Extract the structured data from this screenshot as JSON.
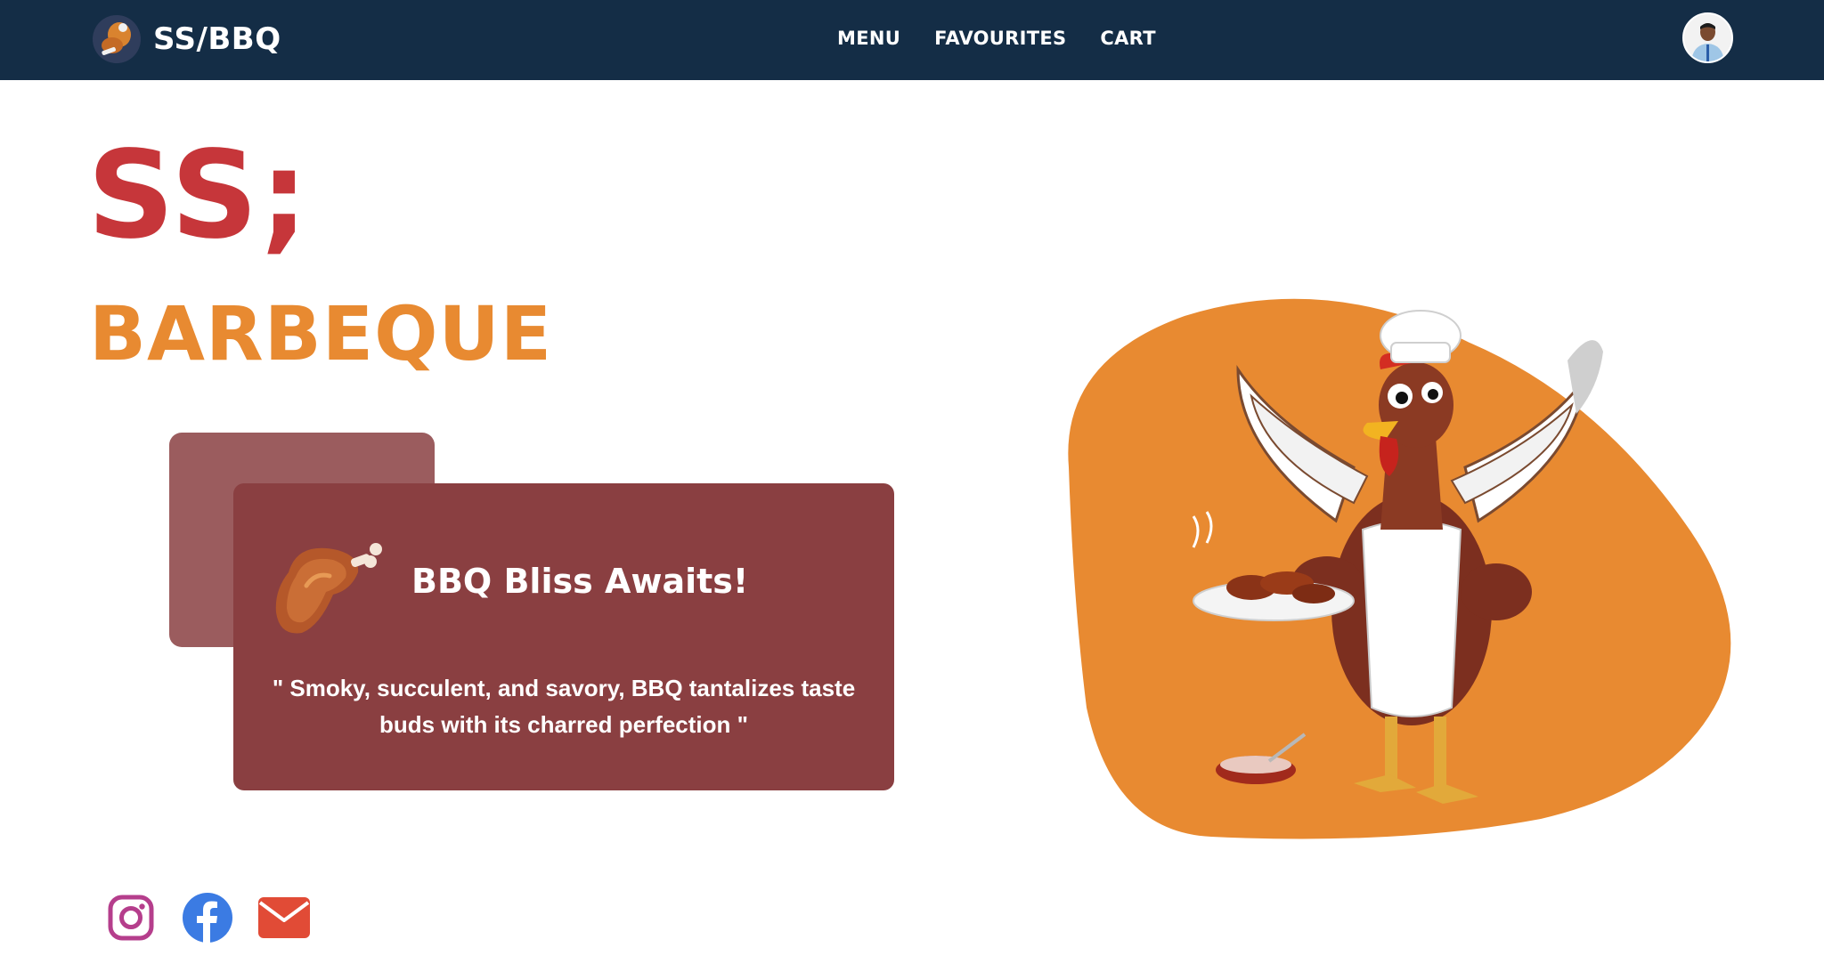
{
  "navbar": {
    "brand_text": "SS/BBQ",
    "logo_icon": "chicken-logo-icon",
    "links": [
      {
        "label": "MENU"
      },
      {
        "label": "FAVOURITES"
      },
      {
        "label": "CART"
      }
    ],
    "avatar_icon": "user-avatar"
  },
  "hero": {
    "title_main": "SS;",
    "title_sub": "BARBEQUE",
    "card": {
      "icon": "drumstick-icon",
      "heading": "BBQ Bliss Awaits!",
      "quote": "\" Smoky, succulent, and savory, BBQ tantalizes taste buds with its charred perfection \""
    },
    "illustration_icon": "chef-rooster-illustration"
  },
  "social": [
    {
      "icon": "instagram-icon",
      "color": "#b53e8c"
    },
    {
      "icon": "facebook-icon",
      "color": "#3b7be3"
    },
    {
      "icon": "email-icon",
      "color": "#e14b36"
    }
  ],
  "colors": {
    "navbar_bg": "#142d46",
    "title_red": "#c6363a",
    "title_orange": "#e88a31",
    "card_bg": "#8a3f41",
    "card_back_bg": "#9b5c5e",
    "blob_orange": "#e88a31"
  }
}
